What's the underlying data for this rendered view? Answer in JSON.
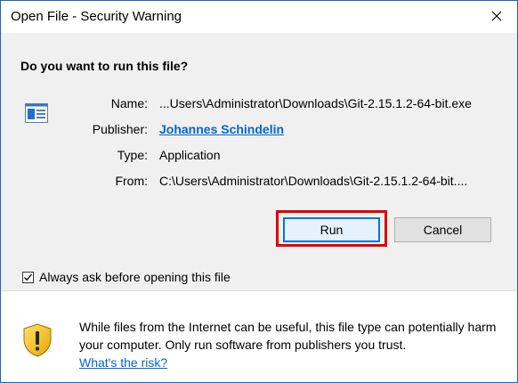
{
  "window": {
    "title": "Open File - Security Warning"
  },
  "dialog": {
    "question": "Do you want to run this file?",
    "fields": [
      {
        "label": "Name:",
        "value": "...Users\\Administrator\\Downloads\\Git-2.15.1.2-64-bit.exe"
      },
      {
        "label": "Publisher:",
        "value": "Johannes Schindelin"
      },
      {
        "label": "Type:",
        "value": "Application"
      },
      {
        "label": "From:",
        "value": "C:\\Users\\Administrator\\Downloads\\Git-2.15.1.2-64-bit...."
      }
    ],
    "run_label": "Run",
    "cancel_label": "Cancel",
    "checkbox_label": "Always ask before opening this file",
    "checkbox_checked": true
  },
  "footer": {
    "warning_text": "While files from the Internet can be useful, this file type can potentially harm your computer. Only run software from publishers you trust.",
    "risk_link": "What's the risk?"
  },
  "colors": {
    "accent": "#0078d7",
    "link": "#0066cc",
    "highlight": "#e00000",
    "window_border": "#1b67b4"
  }
}
